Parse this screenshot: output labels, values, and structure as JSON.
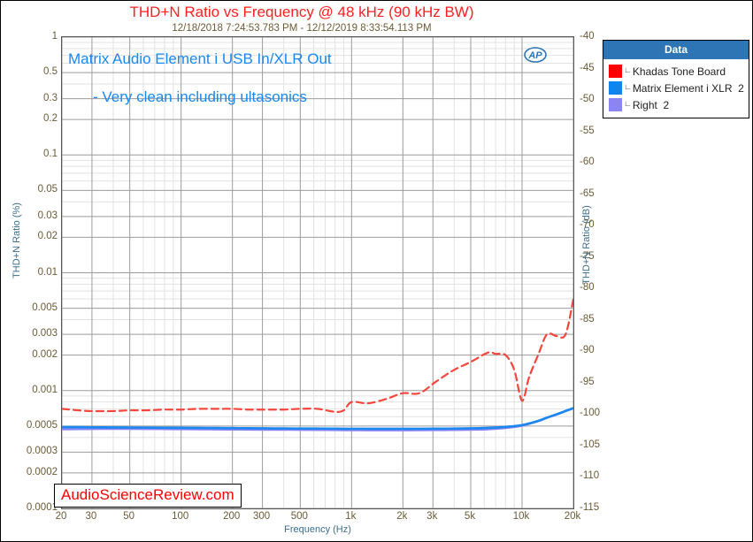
{
  "chart_title": "THD+N Ratio vs Frequency @ 48 kHz (90 kHz BW)",
  "chart_subtitle": "12/18/2018 7:24:53.783 PM - 12/12/2019 8:33:54.113 PM",
  "axes": {
    "x_title": "Frequency (Hz)",
    "y_left_title": "THD+N Ratio (%)",
    "y_right_title": "THD+N Ratio (dB)",
    "x_ticks": [
      "20",
      "30",
      "50",
      "100",
      "200",
      "300",
      "500",
      "1k",
      "2k",
      "3k",
      "5k",
      "10k",
      "20k"
    ],
    "y_left_ticks": [
      "1",
      "0.5",
      "0.3",
      "0.2",
      "0.1",
      "0.05",
      "0.03",
      "0.02",
      "0.01",
      "0.005",
      "0.003",
      "0.002",
      "0.001",
      "0.0005",
      "0.0003",
      "0.0002",
      "0.0001"
    ],
    "y_right_ticks": [
      "-40",
      "-45",
      "-50",
      "-55",
      "-60",
      "-65",
      "-70",
      "-75",
      "-80",
      "-85",
      "-90",
      "-95",
      "-100",
      "-105",
      "-110",
      "-115"
    ]
  },
  "annotations": {
    "line1": "Matrix Audio Element i USB In/XLR Out",
    "line2": "- Very clean including ultasonics",
    "watermark": "AudioScienceReview.com",
    "ap_logo": "AP"
  },
  "legend": {
    "header": "Data",
    "items": [
      {
        "label": "Khadas Tone Board",
        "suffix": "",
        "color": "#ff0000"
      },
      {
        "label": "Matrix Element i XLR",
        "suffix": "2",
        "color": "#0f86ef"
      },
      {
        "label": "Right",
        "suffix": "2",
        "color": "#8a84f5"
      }
    ]
  },
  "colors": {
    "title": "#ff2020",
    "subtitle": "#6b5a36",
    "axis_text": "#6b5a36",
    "axis_title": "#3c6e8f",
    "annotation": "#1a88f0",
    "watermark": "#ff0000",
    "legend_header_bg": "#2e75b6",
    "series_red": "#f4463c",
    "series_blue": "#1a88f0",
    "series_purple": "#8a84f5",
    "grid_major": "#9b9b9b",
    "grid_minor": "#e2e2e2"
  },
  "chart_data": {
    "type": "line",
    "title": "THD+N Ratio vs Frequency @ 48 kHz (90 kHz BW)",
    "subtitle": "12/18/2018 7:24:53.783 PM - 12/12/2019 8:33:54.113 PM",
    "xlabel": "Frequency (Hz)",
    "ylabel": "THD+N Ratio (%)",
    "ylabel_right": "THD+N Ratio (dB)",
    "xscale": "log",
    "yscale": "log",
    "xlim": [
      20,
      20000
    ],
    "ylim": [
      0.0001,
      1
    ],
    "ylim_right_db": [
      -115,
      -40
    ],
    "grid": true,
    "legend_position": "outside-right",
    "series": [
      {
        "name": "Khadas Tone Board",
        "color": "#f4463c",
        "style": "dashed",
        "x": [
          20,
          25,
          30,
          40,
          50,
          63,
          80,
          100,
          125,
          160,
          200,
          250,
          315,
          400,
          500,
          630,
          800,
          900,
          1000,
          1250,
          1600,
          2000,
          2500,
          3150,
          4000,
          5000,
          6300,
          7000,
          8000,
          9000,
          10000,
          11000,
          12500,
          14000,
          16000,
          18000,
          20000
        ],
        "y": [
          0.0007,
          0.00068,
          0.00067,
          0.00067,
          0.00068,
          0.00068,
          0.00069,
          0.00069,
          0.0007,
          0.0007,
          0.0007,
          0.00069,
          0.00069,
          0.00069,
          0.0007,
          0.0007,
          0.00066,
          0.00068,
          0.0008,
          0.00078,
          0.00085,
          0.00095,
          0.00095,
          0.0012,
          0.0015,
          0.00175,
          0.0021,
          0.00205,
          0.002,
          0.0015,
          0.00082,
          0.0013,
          0.00205,
          0.003,
          0.0029,
          0.003,
          0.006
        ]
      },
      {
        "name": "Matrix Element i XLR 2",
        "color": "#1a88f0",
        "style": "solid",
        "x": [
          20,
          25,
          30,
          40,
          50,
          63,
          80,
          100,
          125,
          160,
          200,
          250,
          315,
          400,
          500,
          630,
          800,
          1000,
          1250,
          1600,
          2000,
          2500,
          3150,
          4000,
          5000,
          6300,
          8000,
          10000,
          12500,
          14000,
          16000,
          18000,
          20000
        ],
        "y": [
          0.00049,
          0.00049,
          0.000488,
          0.000487,
          0.000486,
          0.000485,
          0.000484,
          0.000483,
          0.000482,
          0.000481,
          0.00048,
          0.000479,
          0.000478,
          0.000477,
          0.000476,
          0.000476,
          0.000475,
          0.000474,
          0.000474,
          0.000474,
          0.000474,
          0.000474,
          0.000475,
          0.000476,
          0.000478,
          0.000482,
          0.000492,
          0.00051,
          0.000555,
          0.00059,
          0.00063,
          0.000672,
          0.00071
        ]
      },
      {
        "name": "Right 2",
        "color": "#8a84f5",
        "style": "solid",
        "x": [
          20,
          25,
          30,
          40,
          50,
          63,
          80,
          100,
          125,
          160,
          200,
          250,
          315,
          400,
          500,
          630,
          800,
          1000,
          1250,
          1600,
          2000,
          2500,
          3150,
          4000,
          5000,
          6300,
          8000,
          10000,
          12500,
          14000,
          16000,
          18000,
          20000
        ],
        "y": [
          0.00047,
          0.000472,
          0.000473,
          0.000474,
          0.000474,
          0.000473,
          0.000472,
          0.000471,
          0.00047,
          0.000469,
          0.000468,
          0.000467,
          0.000466,
          0.000466,
          0.000465,
          0.000464,
          0.000463,
          0.000462,
          0.000461,
          0.000461,
          0.000461,
          0.000462,
          0.000463,
          0.000464,
          0.000466,
          0.00047,
          0.000482,
          0.000505,
          0.000552,
          0.000588,
          0.000628,
          0.00067,
          0.000708
        ]
      }
    ]
  }
}
